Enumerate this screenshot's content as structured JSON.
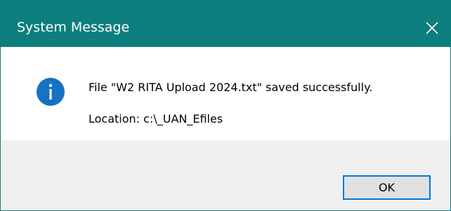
{
  "dialog": {
    "title": "System Message",
    "close_icon": "close-icon",
    "icon": "info-icon",
    "message_line_1": "File \"W2 RITA Upload 2024.txt\" saved successfully.",
    "message_line_2": "Location: c:\\_UAN_Efiles",
    "ok_label": "OK"
  },
  "colors": {
    "titlebar": "#0c7e7e",
    "title_text": "#ffffff",
    "info_icon": "#1572c4",
    "footer": "#f0f0f0",
    "button_border": "#0078d7",
    "button_bg": "#e1e1e1"
  }
}
